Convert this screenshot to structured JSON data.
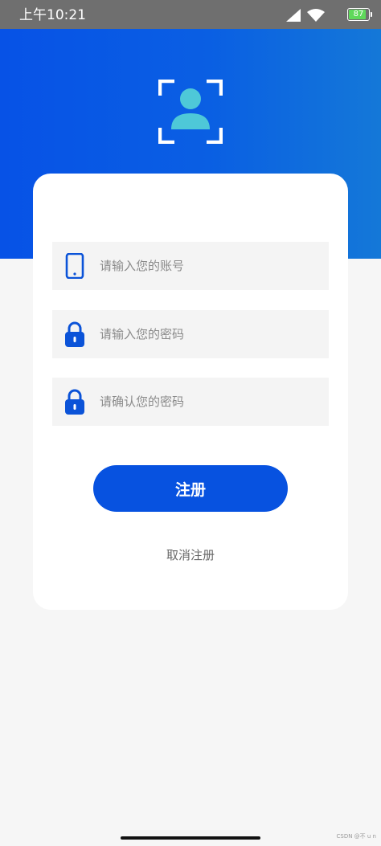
{
  "status_bar": {
    "time": "上午10:21",
    "battery": "87",
    "battery_level": 0.87,
    "battery_color": "#5fd95b"
  },
  "header": {
    "gradient_start": "#0752e6",
    "gradient_end": "#1478d8",
    "icon": "user-scan-icon",
    "icon_color": "#4ec8d8"
  },
  "form": {
    "account": {
      "placeholder": "请输入您的账号",
      "value": "",
      "icon": "phone-icon"
    },
    "password": {
      "placeholder": "请输入您的密码",
      "value": "",
      "icon": "lock-icon"
    },
    "confirm_password": {
      "placeholder": "请确认您的密码",
      "value": "",
      "icon": "lock-icon"
    }
  },
  "actions": {
    "register_label": "注册",
    "cancel_label": "取消注册",
    "accent_color": "#0752e0"
  },
  "watermark": "CSDN @不 u n"
}
